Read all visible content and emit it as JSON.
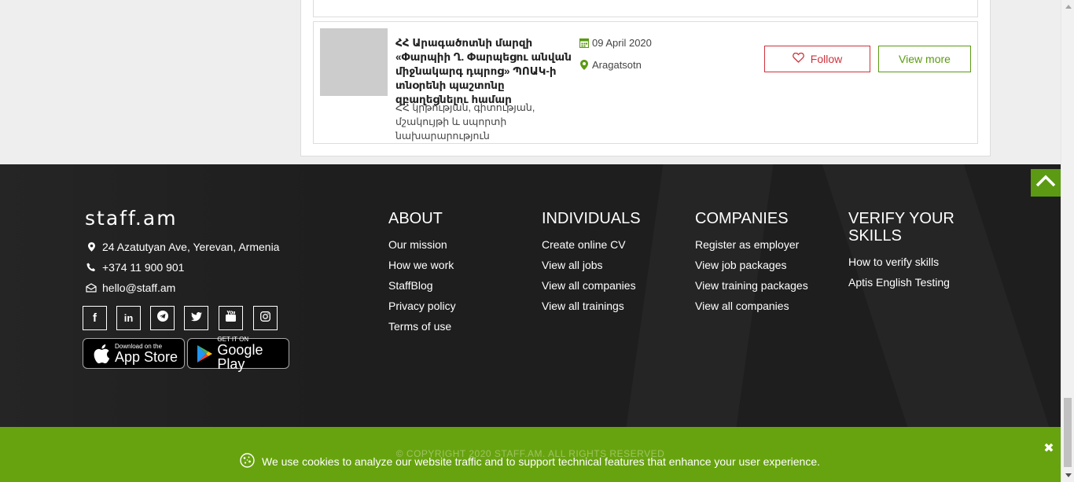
{
  "job_card": {
    "title": "ՀՀ Արագածոտնի մարզի «Փարպիի Ղ. Փարպեցու անվան միջնակարգ դպրոց» ՊՈԱԿ-ի տնօրենի պաշտոնը զբաղեցնելու համար",
    "organization": "ՀՀ կրթության, գիտության, մշակույթի և սպորտի նախարարություն",
    "date": "09 April 2020",
    "location": "Aragatsotn",
    "follow_label": "Follow",
    "view_more_label": "View more"
  },
  "footer": {
    "logo_text": "staff.am",
    "address": "24 Azatutyan Ave, Yerevan, Armenia",
    "phone": "+374 11 900 901",
    "email": "hello@staff.am",
    "social_icons": [
      "facebook-icon",
      "linkedin-icon",
      "telegram-icon",
      "twitter-icon",
      "youtube-icon",
      "instagram-icon"
    ],
    "app_store": {
      "small": "Download on the",
      "big": "App Store"
    },
    "google_play": {
      "small": "GET IT ON",
      "big": "Google Play"
    },
    "columns": {
      "about": {
        "title": "ABOUT",
        "links": [
          "Our mission",
          "How we work",
          "StaffBlog",
          "Privacy policy",
          "Terms of use"
        ]
      },
      "individuals": {
        "title": "INDIVIDUALS",
        "links": [
          "Create online CV",
          "View all jobs",
          "View all companies",
          "View all trainings"
        ]
      },
      "companies": {
        "title": "COMPANIES",
        "links": [
          "Register as employer",
          "View job packages",
          "View training packages",
          "View all companies"
        ]
      },
      "verify": {
        "title": "VERIFY YOUR SKILLS",
        "links": [
          "How to verify skills",
          "Aptis English Testing"
        ]
      }
    },
    "copyright": "© COPYRIGHT 2020 STAFF.AM. ALL RIGHTS RESERVED"
  },
  "cookie": {
    "text": "We use cookies to analyze our website traffic and to support technical features that enhance your user experience.",
    "close": "✖"
  },
  "colors": {
    "accent_green": "#5b9a12",
    "cookie_green": "#67a30e",
    "follow_red": "#d0323c",
    "footer_bg": "#1e1e1e"
  }
}
